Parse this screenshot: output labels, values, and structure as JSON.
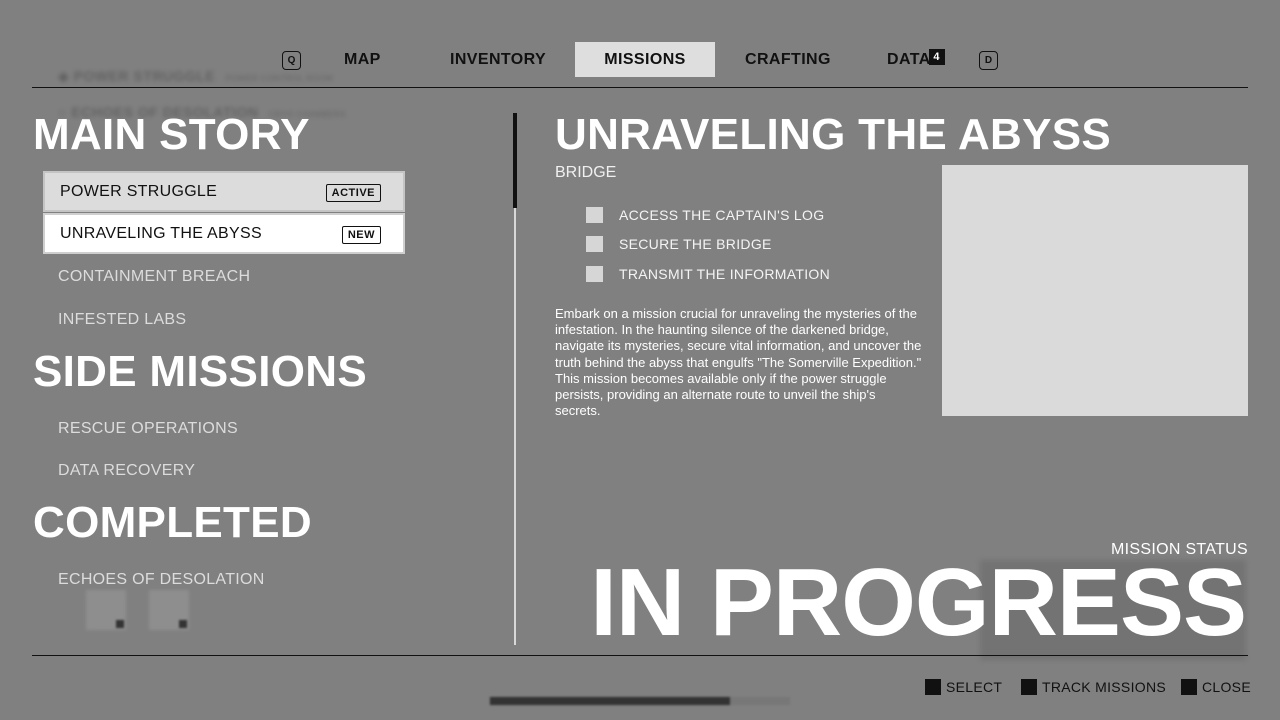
{
  "background_ghosts": {
    "line1_title": "POWER STRUGGLE",
    "line1_sub": "POWER CONTROL ROOM",
    "line2_title": "ECHOES OF DESOLATION",
    "line2_sub": "CRYO CHAMBERS"
  },
  "tabs": {
    "prev_key": "Q",
    "next_key": "D",
    "items": [
      {
        "label": "MAP"
      },
      {
        "label": "INVENTORY"
      },
      {
        "label": "MISSIONS"
      },
      {
        "label": "CRAFTING"
      },
      {
        "label": "DATA",
        "badge": "4"
      }
    ],
    "active": "MISSIONS"
  },
  "sections": {
    "main_story": {
      "heading": "MAIN STORY",
      "items": [
        {
          "label": "POWER STRUGGLE",
          "tag": "ACTIVE"
        },
        {
          "label": "UNRAVELING THE ABYSS",
          "tag": "NEW"
        },
        {
          "label": "CONTAINMENT BREACH"
        },
        {
          "label": "INFESTED LABS"
        }
      ]
    },
    "side_missions": {
      "heading": "SIDE MISSIONS",
      "items": [
        {
          "label": "RESCUE OPERATIONS"
        },
        {
          "label": "DATA RECOVERY"
        }
      ]
    },
    "completed": {
      "heading": "COMPLETED",
      "items": [
        {
          "label": "ECHOES OF DESOLATION"
        }
      ]
    }
  },
  "mission": {
    "title": "UNRAVELING THE ABYSS",
    "location": "BRIDGE",
    "objectives": [
      {
        "label": "ACCESS THE CAPTAIN'S LOG",
        "done": false
      },
      {
        "label": "SECURE THE BRIDGE",
        "done": false
      },
      {
        "label": "TRANSMIT THE INFORMATION",
        "done": false
      }
    ],
    "description": "Embark on a mission crucial for unraveling the mysteries of the infestation. In the haunting silence of the darkened bridge, navigate its mysteries, secure vital information, and uncover the truth behind the abyss that engulfs \"The Somerville Expedition.\" This mission becomes available only if the power struggle persists, providing an alternate route to unveil the ship's secrets.",
    "status_label": "MISSION STATUS",
    "status_value": "IN PROGRESS"
  },
  "footer": {
    "actions": [
      {
        "label": "SELECT"
      },
      {
        "label": "TRACK MISSIONS"
      },
      {
        "label": "CLOSE"
      }
    ],
    "scroll_progress": 0.8
  },
  "colors": {
    "background": "#808080",
    "selected_row": "#dcdcdc",
    "highlight_row": "#ffffff",
    "active_tab": "#dedede",
    "ink": "#111111"
  }
}
